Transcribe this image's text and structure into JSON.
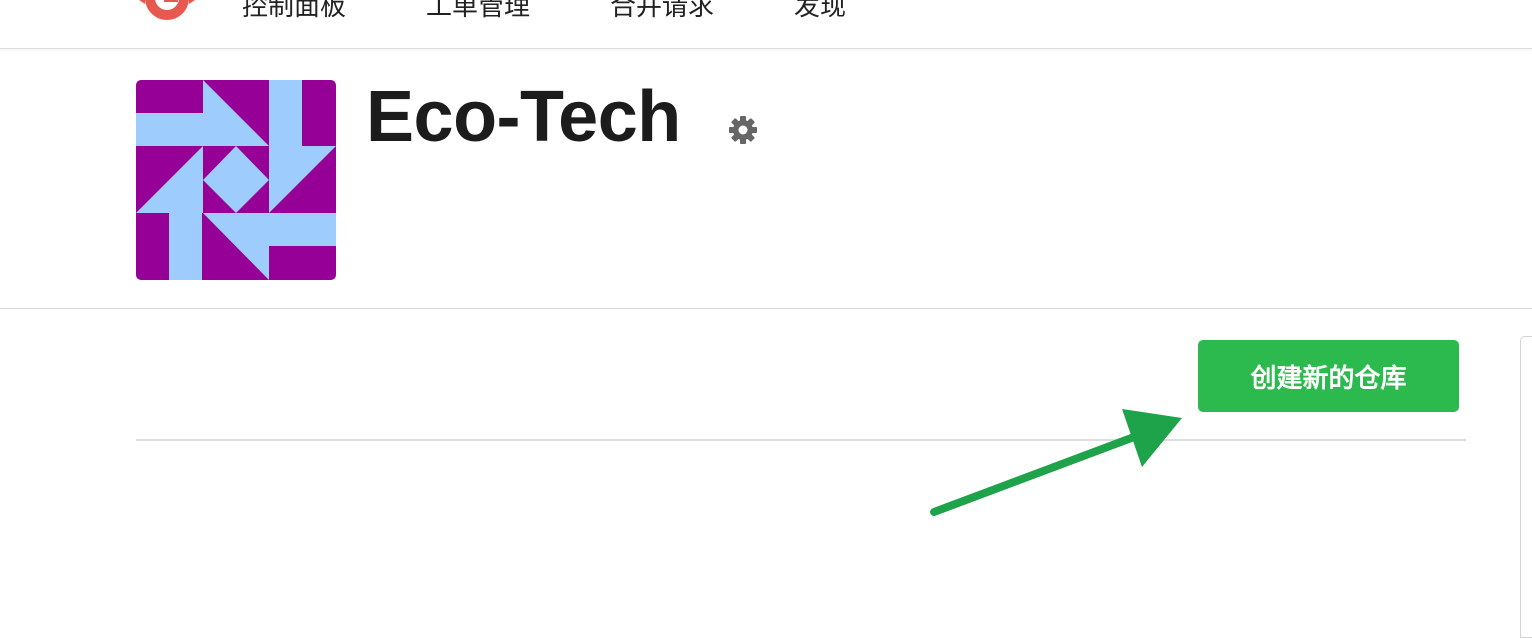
{
  "nav": {
    "items": [
      {
        "label": "控制面板"
      },
      {
        "label": "工单管理"
      },
      {
        "label": "合并请求"
      },
      {
        "label": "发现"
      }
    ]
  },
  "org": {
    "name": "Eco-Tech"
  },
  "actions": {
    "create_repo_label": "创建新的仓库"
  },
  "icons": {
    "logo": "gitea-logo-icon",
    "settings": "gear-icon",
    "annotation": "arrow-annotation-icon"
  },
  "colors": {
    "brand_logo": "#e7594f",
    "avatar_bg": "#960096",
    "avatar_fg": "#9ecdfd",
    "primary_button": "#2cba4e",
    "annotation_arrow": "#1fa34a",
    "settings_icon": "#666666"
  }
}
